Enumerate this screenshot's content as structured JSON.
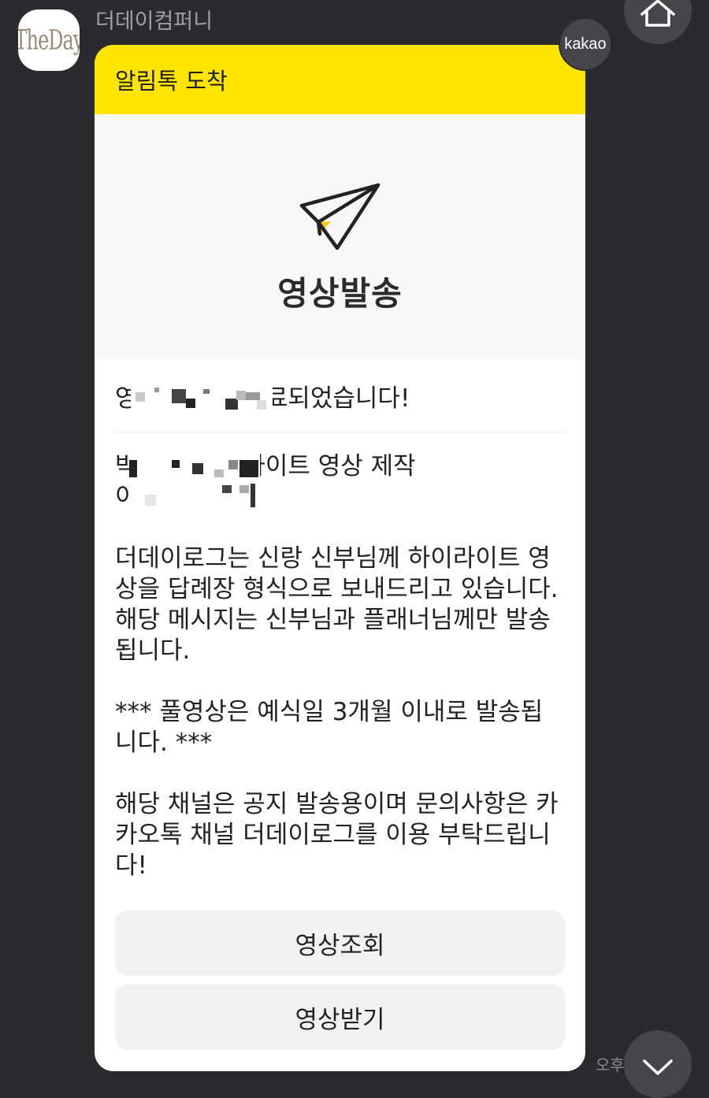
{
  "sender": {
    "name": "더데이컴퍼니",
    "avatar_text": "TheDay"
  },
  "badge": {
    "label": "kakao"
  },
  "header": {
    "title": "알림톡 도착"
  },
  "hero": {
    "icon": "paper-plane-icon",
    "title": "영상발송"
  },
  "message": {
    "headline": "영상 제작이 완료되었습니다!",
    "paragraphs": [
      "박        님의 하이라이트 영상 제작\n이          다.",
      "더데이로그는 신랑 신부님께 하이라이트 영\n상을 답례장 형식으로 보내드리고 있습니다.\n해당 메시지는 신부님과 플래너님께만 발송\n됩니다.",
      "*** 풀영상은 예식일 3개월 이내로 발송됩\n니다. ***",
      "해당 채널은 공지 발송용이며 문의사항은 카\n카오톡 채널 더데이로그를 이용 부탁드립니\n다!"
    ]
  },
  "buttons": {
    "view_label": "영상조회",
    "download_label": "영상받기"
  },
  "timestamp": "오후",
  "colors": {
    "background": "#2a2b2e",
    "header_yellow": "#fee500",
    "button_bg": "#f1f1f2"
  }
}
